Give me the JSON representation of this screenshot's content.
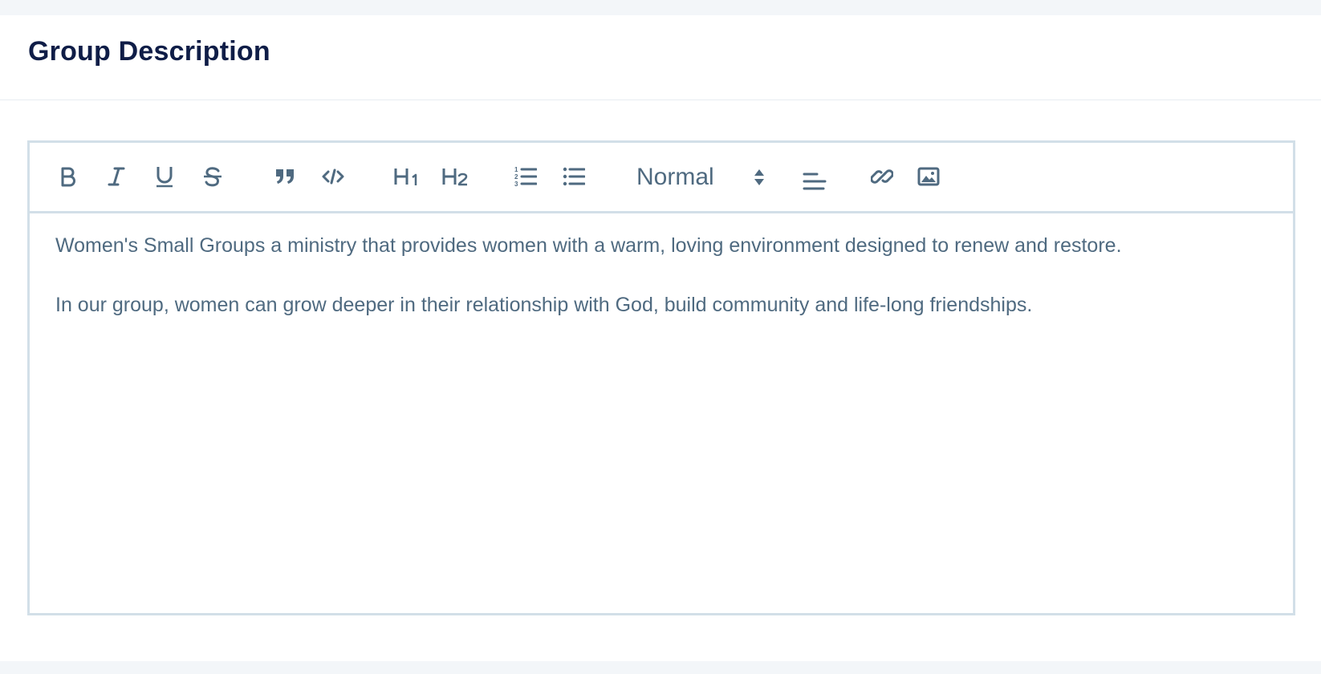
{
  "section": {
    "title": "Group Description"
  },
  "toolbar": {
    "buttons": [
      {
        "name": "bold-button",
        "icon": "bold-icon"
      },
      {
        "name": "italic-button",
        "icon": "italic-icon"
      },
      {
        "name": "underline-button",
        "icon": "underline-icon"
      },
      {
        "name": "strikethrough-button",
        "icon": "strikethrough-icon"
      },
      {
        "name": "blockquote-button",
        "icon": "quote-icon"
      },
      {
        "name": "code-button",
        "icon": "code-icon"
      },
      {
        "name": "heading1-button",
        "label": "H1"
      },
      {
        "name": "heading2-button",
        "label": "H2"
      },
      {
        "name": "ordered-list-button",
        "icon": "ordered-list-icon"
      },
      {
        "name": "bullet-list-button",
        "icon": "bullet-list-icon"
      },
      {
        "name": "align-button",
        "icon": "align-left-icon"
      },
      {
        "name": "link-button",
        "icon": "link-icon"
      },
      {
        "name": "image-button",
        "icon": "image-icon"
      }
    ],
    "format_select": {
      "value": "Normal"
    },
    "icon_color": "#4f6a80"
  },
  "editor": {
    "paragraphs": [
      "Women's Small Groups a ministry that provides women with a warm, loving environment designed to renew and restore.",
      "In our group, women can grow deeper in their relationship with God, build community and life-long friendships."
    ]
  },
  "colors": {
    "title": "#0f1d47",
    "text": "#4f6a80",
    "border": "#d2dfe8",
    "background": "#f3f6f9"
  }
}
